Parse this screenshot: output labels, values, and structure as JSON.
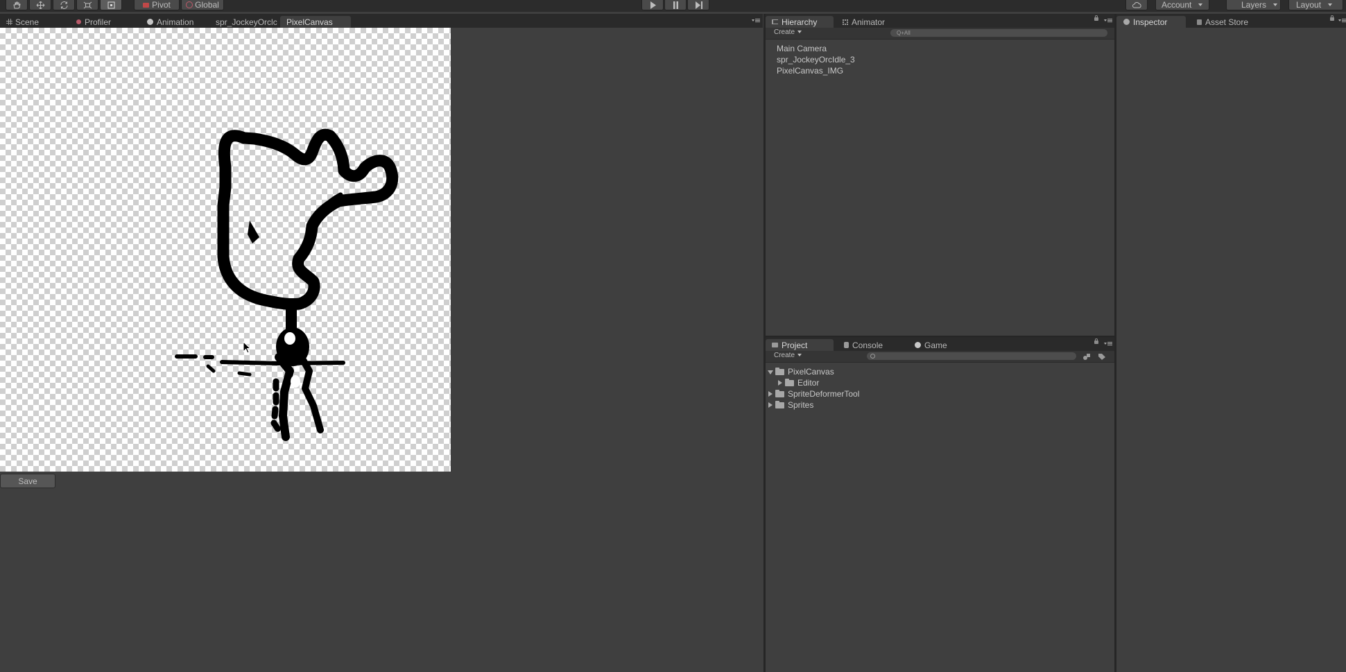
{
  "toolbar": {
    "pivot_label": "Pivot",
    "global_label": "Global",
    "account_label": "Account",
    "layers_label": "Layers",
    "layout_label": "Layout",
    "tool_icons": [
      "hand-icon",
      "move-icon",
      "rotate-icon",
      "scale-icon",
      "rect-tool-icon"
    ],
    "playback_icons": [
      "play-icon",
      "pause-icon",
      "step-icon"
    ]
  },
  "scene_tabs": {
    "tabs": [
      {
        "label": "Scene",
        "icon": "grid-icon"
      },
      {
        "label": "Profiler",
        "icon": "profiler-icon"
      },
      {
        "label": "Animation",
        "icon": "animation-icon"
      },
      {
        "label": "spr_JockeyOrclc",
        "icon": ""
      },
      {
        "label": "PixelCanvas",
        "icon": ""
      }
    ]
  },
  "pixel_canvas": {
    "save_label": "Save",
    "drawing_description_icon": "sprite-drawing"
  },
  "hierarchy": {
    "tabs": [
      {
        "label": "Hierarchy",
        "icon": "hierarchy-icon"
      },
      {
        "label": "Animator",
        "icon": "animator-icon"
      }
    ],
    "create_label": "Create",
    "search_placeholder": "Q+All",
    "items": [
      "Main Camera",
      "spr_JockeyOrcIdle_3",
      "PixelCanvas_IMG"
    ]
  },
  "project": {
    "tabs": [
      {
        "label": "Project",
        "icon": "folder-icon"
      },
      {
        "label": "Console",
        "icon": "console-icon"
      },
      {
        "label": "Game",
        "icon": "game-icon"
      }
    ],
    "create_label": "Create",
    "tree": [
      {
        "label": "PixelCanvas",
        "expanded": true,
        "depth": 0
      },
      {
        "label": "Editor",
        "expanded": false,
        "depth": 1
      },
      {
        "label": "SpriteDeformerTool",
        "expanded": false,
        "depth": 0
      },
      {
        "label": "Sprites",
        "expanded": false,
        "depth": 0
      }
    ]
  },
  "inspector": {
    "tabs": [
      {
        "label": "Inspector",
        "icon": "info-icon"
      },
      {
        "label": "Asset Store",
        "icon": "store-icon"
      }
    ]
  },
  "colors": {
    "background": "#3f3f3f",
    "toolbar": "#2c2c2c",
    "tab_strip": "#2a2a2a"
  }
}
